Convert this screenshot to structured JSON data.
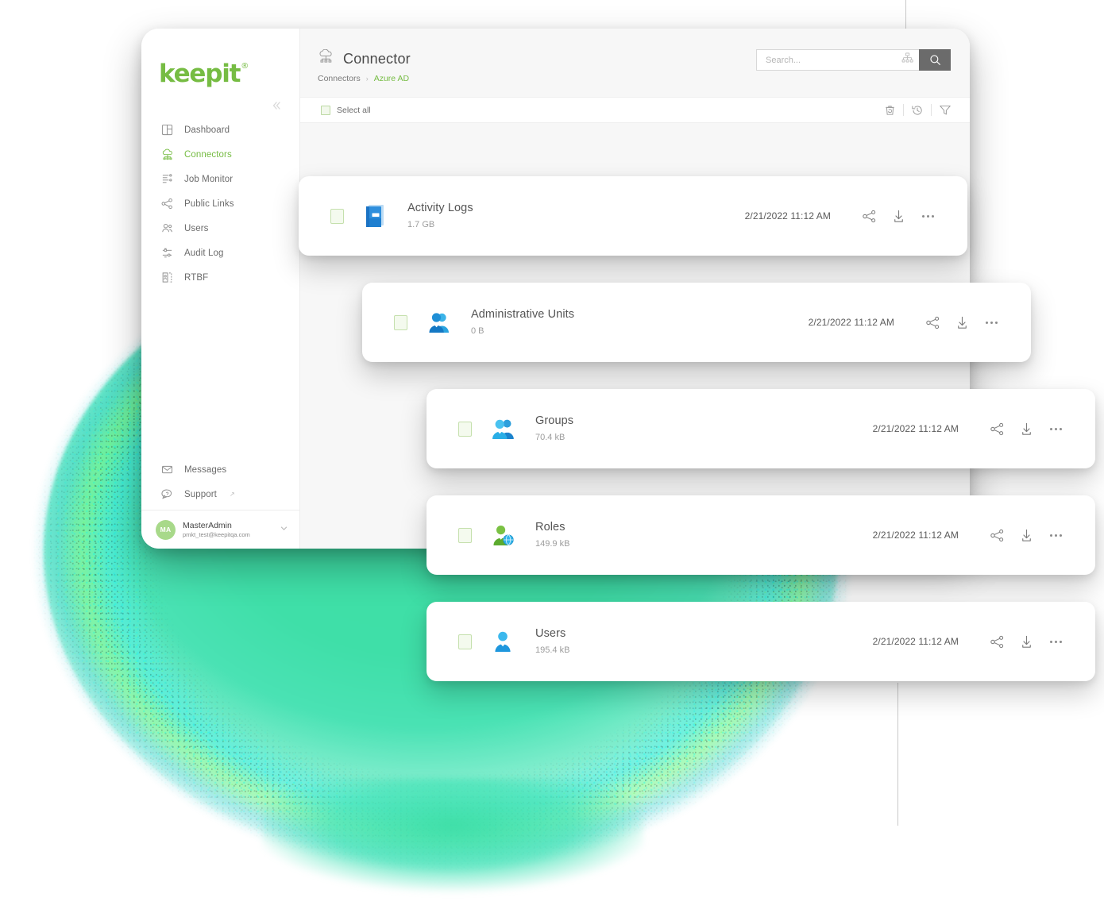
{
  "brand": {
    "logo_text": "keepit",
    "registered_mark": "®",
    "accent_green": "#76bc43",
    "blob_green": "#3fdfa8"
  },
  "sidebar": {
    "collapse_icon": "chevron-double-left-icon",
    "items": [
      {
        "label": "Dashboard",
        "icon": "dashboard-icon",
        "active": false
      },
      {
        "label": "Connectors",
        "icon": "cloud-connector-icon",
        "active": true
      },
      {
        "label": "Job Monitor",
        "icon": "job-monitor-icon",
        "active": false
      },
      {
        "label": "Public Links",
        "icon": "share-nodes-icon",
        "active": false
      },
      {
        "label": "Users",
        "icon": "users-icon",
        "active": false
      },
      {
        "label": "Audit Log",
        "icon": "audit-log-icon",
        "active": false
      },
      {
        "label": "RTBF",
        "icon": "rtbf-icon",
        "active": false
      }
    ],
    "bottom_items": [
      {
        "label": "Messages",
        "icon": "envelope-icon",
        "external": false
      },
      {
        "label": "Support",
        "icon": "support-chat-icon",
        "external": true,
        "external_mark": "↗"
      }
    ],
    "user": {
      "initials": "MA",
      "name": "MasterAdmin",
      "email": "pmkt_test@keepitqa.com",
      "chevron": "chevron-down-icon"
    }
  },
  "header": {
    "icon": "cloud-connector-icon",
    "title": "Connector",
    "breadcrumbs": [
      {
        "label": "Connectors",
        "current": false
      },
      {
        "label": "Azure AD",
        "current": true
      }
    ],
    "breadcrumb_separator": "›"
  },
  "search": {
    "placeholder": "Search...",
    "value": "",
    "scope_icon": "sitemap-icon",
    "submit_icon": "search-icon"
  },
  "toolbar": {
    "select_all_label": "Select all",
    "select_all_checked": false,
    "actions": [
      {
        "name": "restore-deleted-icon",
        "glyph": "trash-restore"
      },
      {
        "name": "snapshot-history-icon",
        "glyph": "clock-history"
      },
      {
        "name": "filter-icon",
        "glyph": "funnel"
      }
    ]
  },
  "rows": [
    {
      "name": "Activity Logs",
      "size": "1.7 GB",
      "date": "2/21/2022 11:12 AM",
      "icon": "blue-book-icon",
      "checked": false
    },
    {
      "name": "Administrative Units",
      "size": "0 B",
      "date": "2/21/2022 11:12 AM",
      "icon": "admin-unit-person-icon",
      "checked": false
    },
    {
      "name": "Groups",
      "size": "70.4 kB",
      "date": "2/21/2022 11:12 AM",
      "icon": "group-people-icon",
      "checked": false
    },
    {
      "name": "Roles",
      "size": "149.9 kB",
      "date": "2/21/2022 11:12 AM",
      "icon": "role-person-globe-icon",
      "checked": false
    },
    {
      "name": "Users",
      "size": "195.4 kB",
      "date": "2/21/2022 11:12 AM",
      "icon": "user-person-icon",
      "checked": false
    }
  ],
  "row_actions": [
    {
      "name": "share-icon"
    },
    {
      "name": "download-icon"
    },
    {
      "name": "more-options-icon"
    }
  ]
}
